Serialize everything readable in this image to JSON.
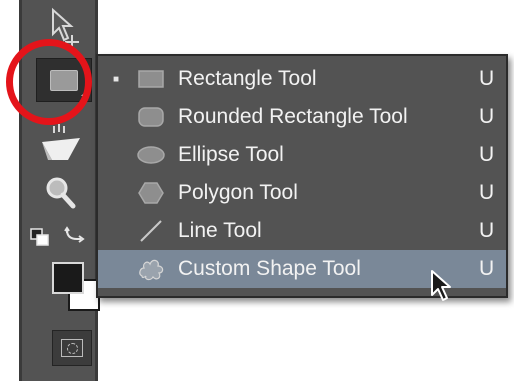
{
  "colors": {
    "panel": "#535353",
    "selected_row": "#7a8898",
    "highlight_ring": "#e4141a",
    "text": "#f2f2f2"
  },
  "toolbar": {
    "tools": [
      {
        "name": "move-tool",
        "icon": "move-arrow-icon"
      },
      {
        "name": "rectangle-tool-group",
        "icon": "rectangle-icon",
        "active": true
      },
      {
        "name": "paint-bucket-tool",
        "icon": "bucket-icon"
      },
      {
        "name": "zoom-tool",
        "icon": "magnifier-icon"
      },
      {
        "name": "default-colors",
        "icon": "default-colors-icon"
      },
      {
        "name": "swap-colors",
        "icon": "swap-arrow-icon"
      },
      {
        "name": "quick-mask",
        "icon": "quick-mask-icon"
      }
    ]
  },
  "flyout": {
    "items": [
      {
        "label": "Rectangle Tool",
        "shortcut": "U",
        "icon": "rectangle-icon",
        "checked": true
      },
      {
        "label": "Rounded Rectangle Tool",
        "shortcut": "U",
        "icon": "rounded-rectangle-icon"
      },
      {
        "label": "Ellipse Tool",
        "shortcut": "U",
        "icon": "ellipse-icon"
      },
      {
        "label": "Polygon Tool",
        "shortcut": "U",
        "icon": "polygon-icon"
      },
      {
        "label": "Line Tool",
        "shortcut": "U",
        "icon": "line-icon"
      },
      {
        "label": "Custom Shape Tool",
        "shortcut": "U",
        "icon": "custom-shape-icon",
        "selected": true
      }
    ]
  }
}
